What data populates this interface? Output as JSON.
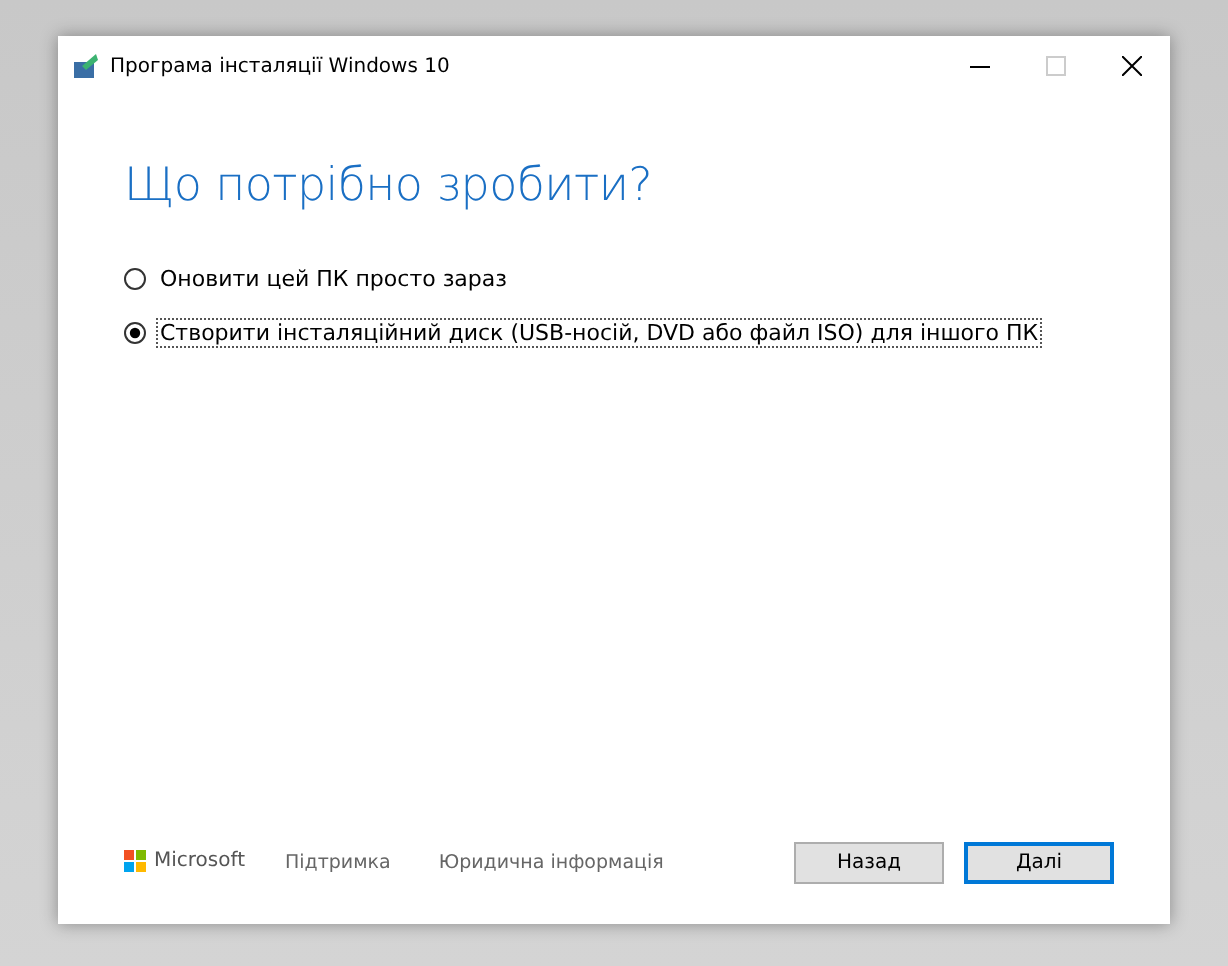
{
  "window": {
    "title": "Програма інсталяції Windows 10"
  },
  "heading": "Що потрібно зробити?",
  "options": [
    {
      "label": "Оновити цей ПК просто зараз",
      "selected": false
    },
    {
      "label": "Створити інсталяційний диск (USB-носій, DVD або файл ISO) для іншого ПК",
      "selected": true
    }
  ],
  "footer": {
    "brand": "Microsoft",
    "links": [
      "Підтримка",
      "Юридична інформація"
    ]
  },
  "buttons": [
    {
      "label": "Назад",
      "kind": "secondary"
    },
    {
      "label": "Далі",
      "kind": "primary"
    }
  ]
}
